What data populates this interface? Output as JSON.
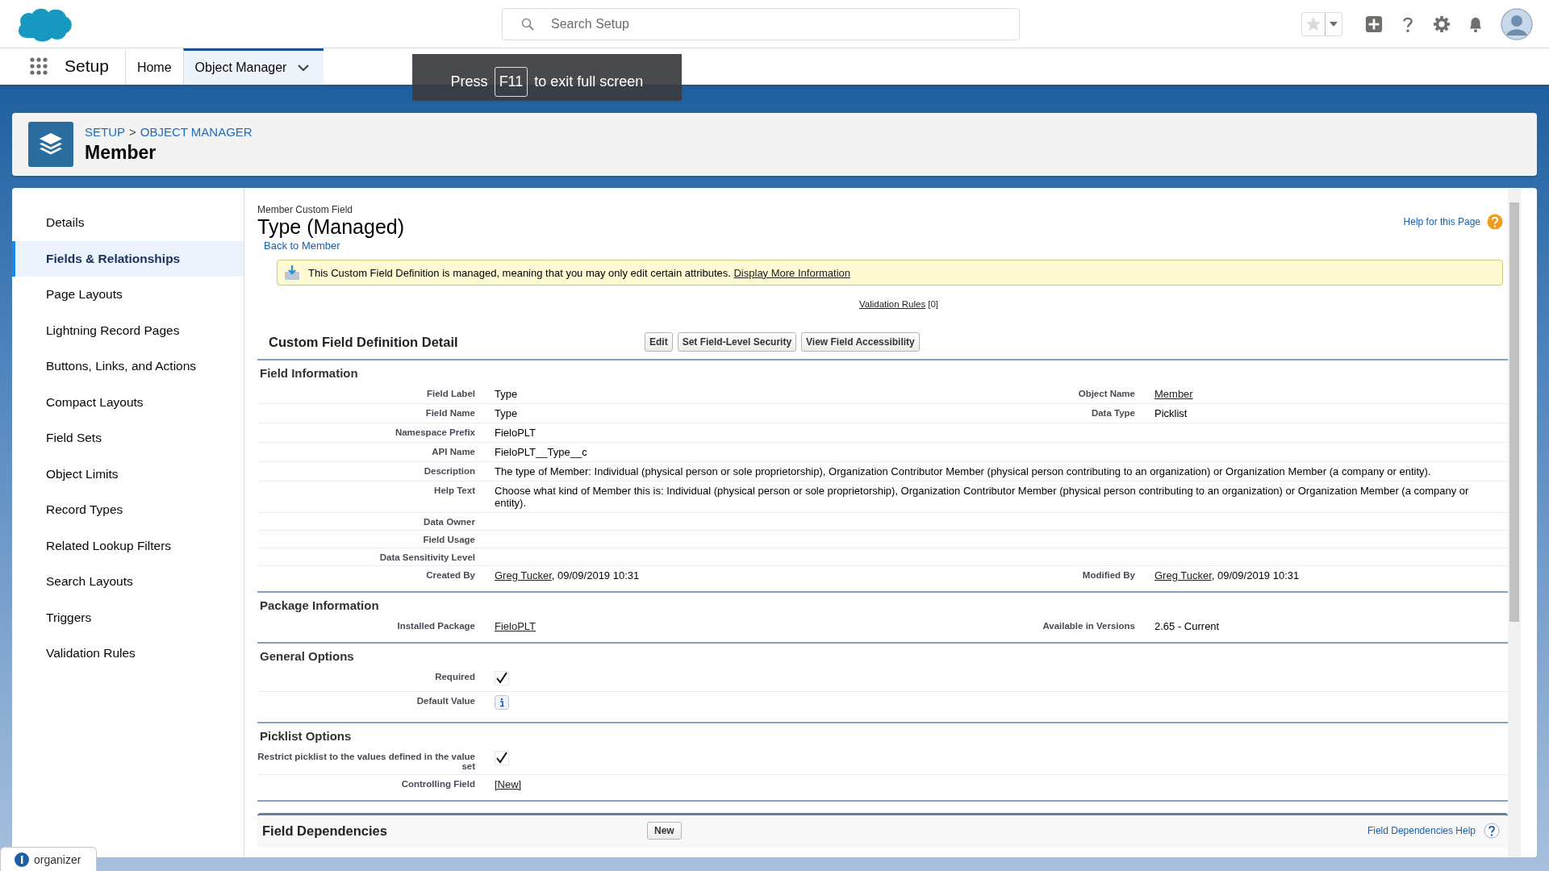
{
  "header": {
    "search": {
      "placeholder": "Search Setup"
    }
  },
  "nav": {
    "app_name": "Setup",
    "tabs": [
      {
        "label": "Home",
        "selected": false,
        "has_menu": false
      },
      {
        "label": "Object Manager",
        "selected": true,
        "has_menu": true
      }
    ]
  },
  "fullscreen_notice": {
    "before": "Press",
    "key": "F11",
    "after": "to exit full screen"
  },
  "page_header": {
    "breadcrumbs": [
      "SETUP",
      "OBJECT MANAGER"
    ],
    "separator": ">",
    "title": "Member"
  },
  "sidebar": {
    "items": [
      {
        "label": "Details",
        "selected": false
      },
      {
        "label": "Fields & Relationships",
        "selected": true
      },
      {
        "label": "Page Layouts",
        "selected": false
      },
      {
        "label": "Lightning Record Pages",
        "selected": false
      },
      {
        "label": "Buttons, Links, and Actions",
        "selected": false
      },
      {
        "label": "Compact Layouts",
        "selected": false
      },
      {
        "label": "Field Sets",
        "selected": false
      },
      {
        "label": "Object Limits",
        "selected": false
      },
      {
        "label": "Record Types",
        "selected": false
      },
      {
        "label": "Related Lookup Filters",
        "selected": false
      },
      {
        "label": "Search Layouts",
        "selected": false
      },
      {
        "label": "Triggers",
        "selected": false
      },
      {
        "label": "Validation Rules",
        "selected": false
      }
    ]
  },
  "detail": {
    "eyebrow": "Member Custom Field",
    "title": "Type (Managed)",
    "back_link": "Back to Member",
    "help_link": "Help for this Page",
    "notice": {
      "text": "This Custom Field Definition is managed, meaning that you may only edit certain attributes.",
      "link": "Display More Information"
    },
    "related": {
      "link": "Validation Rules",
      "count": "[0]"
    },
    "heading": "Custom Field Definition Detail",
    "buttons": [
      "Edit",
      "Set Field-Level Security",
      "View Field Accessibility"
    ],
    "sections": [
      {
        "title": "Field Information",
        "rows": [
          {
            "left": {
              "label": "Field Label",
              "kind": "text",
              "value": "Type"
            },
            "right": {
              "label": "Object Name",
              "kind": "link",
              "link": "Member"
            }
          },
          {
            "left": {
              "label": "Field Name",
              "kind": "text",
              "value": "Type"
            },
            "right": {
              "label": "Data Type",
              "kind": "text",
              "value": "Picklist"
            }
          },
          {
            "left": {
              "label": "Namespace Prefix",
              "kind": "text",
              "value": "FieloPLT"
            }
          },
          {
            "left": {
              "label": "API Name",
              "kind": "text",
              "value": "FieloPLT__Type__c"
            }
          },
          {
            "left": {
              "label": "Description",
              "kind": "text",
              "value": "The type of Member: Individual (physical person or sole proprietorship), Organization Contributor Member (physical person contributing to an organization) or Organization Member (a company or entity)."
            }
          },
          {
            "left": {
              "label": "Help Text",
              "kind": "text",
              "value": "Choose what kind of Member this is: Individual (physical person or sole proprietorship), Organization Contributor Member (physical person contributing to an organization) or Organization Member (a company or entity)."
            }
          },
          {
            "left": {
              "label": "Data Owner",
              "kind": "empty"
            }
          },
          {
            "left": {
              "label": "Field Usage",
              "kind": "empty"
            }
          },
          {
            "left": {
              "label": "Data Sensitivity Level",
              "kind": "empty"
            }
          },
          {
            "left": {
              "label": "Created By",
              "kind": "link",
              "link": "Greg Tucker",
              "suffix": ", 09/09/2019 10:31"
            },
            "right": {
              "label": "Modified By",
              "kind": "link",
              "link": "Greg Tucker",
              "suffix": ", 09/09/2019 10:31"
            }
          }
        ]
      },
      {
        "title": "Package Information",
        "rows": [
          {
            "left": {
              "label": "Installed Package",
              "kind": "link",
              "link": "FieloPLT"
            },
            "right": {
              "label": "Available in Versions",
              "kind": "text",
              "value": "2.65 - Current"
            }
          }
        ]
      },
      {
        "title": "General Options",
        "rows": [
          {
            "left": {
              "label": "Required",
              "kind": "check",
              "checked": true
            }
          },
          {
            "left": {
              "label": "Default Value",
              "kind": "info"
            }
          }
        ]
      },
      {
        "title": "Picklist Options",
        "rows": [
          {
            "left": {
              "label": "Restrict picklist to the values defined in the value set",
              "kind": "check",
              "checked": true
            }
          },
          {
            "left": {
              "label": "Controlling Field",
              "kind": "link",
              "link": "[New]"
            }
          }
        ]
      }
    ],
    "dependencies": {
      "title": "Field Dependencies",
      "button": "New",
      "help_link": "Field Dependencies Help"
    }
  },
  "bottom_tab": {
    "label": "organizer"
  }
}
